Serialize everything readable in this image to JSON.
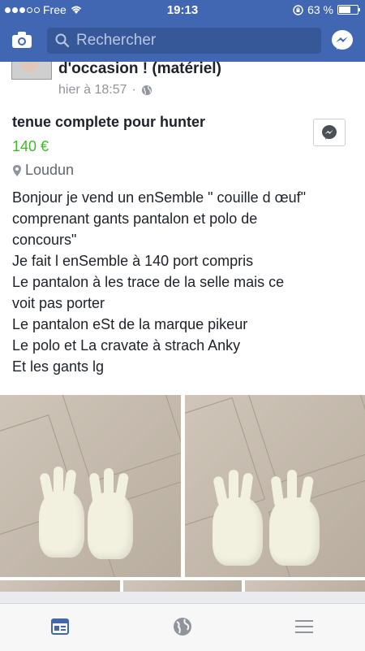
{
  "status": {
    "carrier": "Free",
    "time": "19:13",
    "battery_text": "63 %",
    "battery_level": 0.63
  },
  "toolbar": {
    "search_placeholder": "Rechercher",
    "icons": [
      "camera-icon",
      "search-icon",
      "messenger-icon"
    ]
  },
  "post": {
    "group_title": "d'occasion ! (matériel)",
    "timestamp": "hier à 18:57",
    "separator": "·",
    "privacy_icon": "globe-icon",
    "item_title": "tenue complete pour hunter",
    "price": "140 €",
    "location": "Loudun",
    "description": [
      "Bonjour je vend un enSemble \" couille d œuf\"",
      "comprenant gants pantalon et polo de",
      "concours\"",
      "Je fait l enSemble à 140 port compris",
      "Le pantalon à les trace de la selle mais  ce",
      "voit pas porter",
      "Le pantalon eSt de la marque pikeur",
      "Le polo et La cravate à strach Anky",
      "Et les gants lg"
    ]
  },
  "tabbar": {
    "tabs": [
      "news-feed-icon",
      "globe-icon",
      "menu-icon"
    ]
  },
  "colors": {
    "header": "#4267b2",
    "search": "#365899",
    "price": "#42b72a",
    "active_tab": "#4267b2"
  }
}
